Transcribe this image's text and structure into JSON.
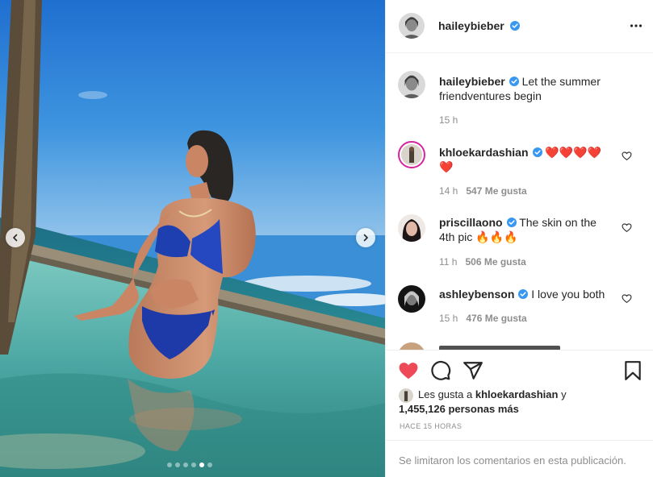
{
  "post": {
    "author": "haileybieber",
    "icons": {
      "verified": "verified-badge-icon",
      "more": "more-options-icon"
    },
    "carousel": {
      "slide_count": 6,
      "active_slide": 5,
      "prev": "chevron-left-icon",
      "next": "chevron-right-icon"
    }
  },
  "caption": {
    "username": "haileybieber",
    "text": "Let the summer friendventures begin",
    "time": "15 h"
  },
  "comments": [
    {
      "username": "khloekardashian",
      "text": "❤️❤️❤️❤️❤️",
      "time": "14 h",
      "likes": "547 Me gusta"
    },
    {
      "username": "priscillaono",
      "text": "The skin on the 4th pic 🔥🔥🔥",
      "time": "11 h",
      "likes": "506 Me gusta"
    },
    {
      "username": "ashleybenson",
      "text": "I love you both",
      "time": "15 h",
      "likes": "476 Me gusta"
    }
  ],
  "actions": {
    "like": "heart-filled-icon",
    "comment": "comment-bubble-icon",
    "share": "paper-plane-icon",
    "save": "bookmark-icon",
    "like_color": "#ed4956"
  },
  "likes": {
    "prefix": "Les gusta a",
    "user": "khloekardashian",
    "joiner": "y",
    "count": "1,455,126 personas más"
  },
  "timestamp": "HACE 15 HORAS",
  "comments_limited": "Se limitaron los comentarios en esta publicación."
}
